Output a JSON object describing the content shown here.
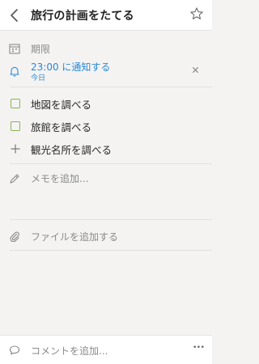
{
  "header": {
    "title": "旅行の計画をたてる"
  },
  "due": {
    "label": "期限"
  },
  "reminder": {
    "time_label": "23:00 に通知する",
    "sub_label": "今日"
  },
  "subtasks": [
    {
      "label": "地図を調べる"
    },
    {
      "label": "旅館を調べる"
    }
  ],
  "add_subtask": {
    "label": "観光名所を調べる"
  },
  "note": {
    "placeholder": "メモを追加..."
  },
  "file": {
    "label": "ファイルを追加する"
  },
  "comment": {
    "placeholder": "コメントを追加..."
  },
  "more": {
    "label": "•••"
  },
  "colors": {
    "accent": "#2b88d8",
    "checkbox": "#8bb25a",
    "muted": "#8a8a8a"
  }
}
